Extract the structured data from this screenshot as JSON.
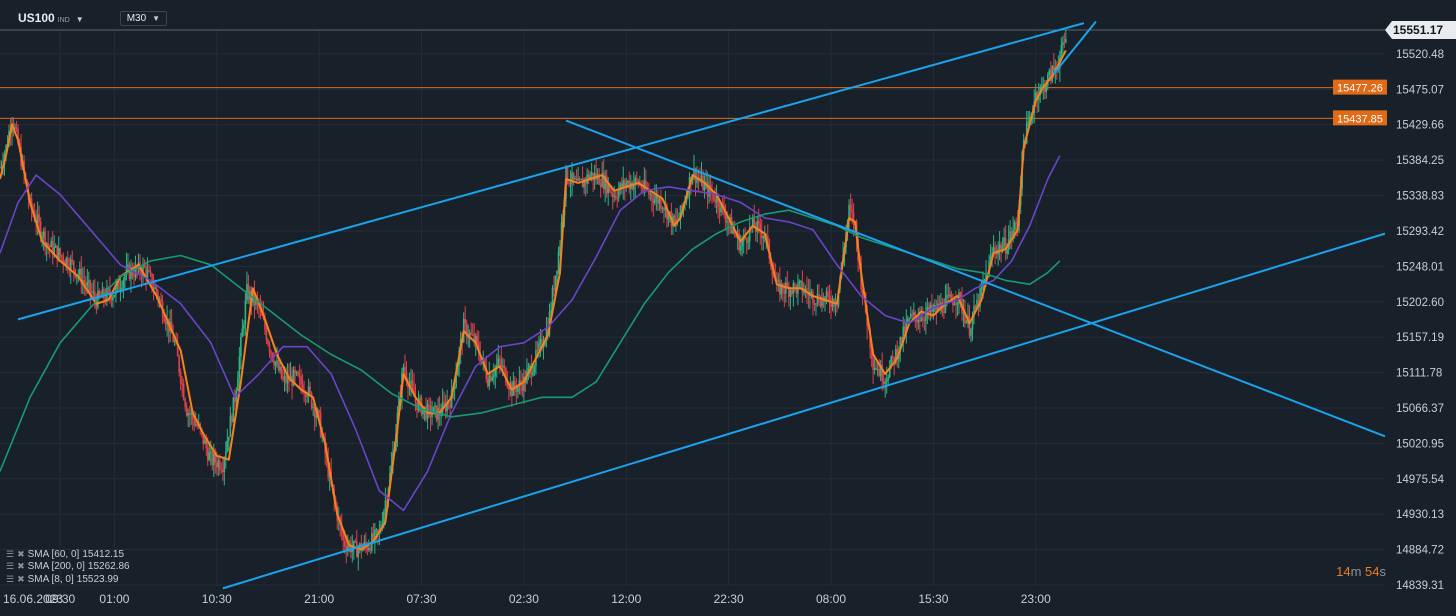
{
  "header": {
    "symbol": "US100",
    "symbol_tag": "IND",
    "timeframe": "M30"
  },
  "colors": {
    "background": "#18202a",
    "grid": "#242d38",
    "candle_up": "#2fb383",
    "candle_down": "#e0414b",
    "sma8": "#f5821f",
    "sma60": "#6a45c8",
    "sma200": "#179a73",
    "trendline": "#1aa3ec",
    "hline": "#e06a16",
    "price_tag": "#e06a16"
  },
  "chart_data": {
    "type": "line",
    "instrument": "US100",
    "timeframe": "M30",
    "ylim": [
      14839.31,
      15551.17
    ],
    "y_ticks": [
      15551.17,
      15520.48,
      15475.07,
      15429.66,
      15384.25,
      15338.83,
      15293.42,
      15248.01,
      15202.6,
      15157.19,
      15111.78,
      15066.37,
      15020.95,
      14975.54,
      14930.13,
      14884.72,
      14839.31
    ],
    "x_tick_labels": [
      "16.06.2023",
      "09:30",
      "01:00",
      "10:30",
      "21:00",
      "07:30",
      "02:30",
      "12:00",
      "22:30",
      "08:00",
      "15:30",
      "23:00"
    ],
    "current_price": "15551.17",
    "horizontal_levels": [
      "15477.26",
      "15437.85"
    ],
    "series": [
      {
        "name": "SMA [8, 0]",
        "value": "15523.99",
        "color": "#f5821f",
        "points": [
          [
            0,
            15360
          ],
          [
            2,
            15390
          ],
          [
            4,
            15430
          ],
          [
            6,
            15410
          ],
          [
            10,
            15330
          ],
          [
            14,
            15280
          ],
          [
            20,
            15255
          ],
          [
            26,
            15235
          ],
          [
            32,
            15200
          ],
          [
            36,
            15205
          ],
          [
            40,
            15235
          ],
          [
            46,
            15250
          ],
          [
            52,
            15210
          ],
          [
            60,
            15140
          ],
          [
            64,
            15060
          ],
          [
            68,
            15030
          ],
          [
            72,
            15005
          ],
          [
            76,
            15000
          ],
          [
            80,
            15100
          ],
          [
            84,
            15220
          ],
          [
            88,
            15180
          ],
          [
            92,
            15135
          ],
          [
            96,
            15105
          ],
          [
            100,
            15090
          ],
          [
            104,
            15080
          ],
          [
            108,
            15020
          ],
          [
            112,
            14930
          ],
          [
            116,
            14890
          ],
          [
            120,
            14885
          ],
          [
            124,
            14895
          ],
          [
            128,
            14920
          ],
          [
            132,
            15040
          ],
          [
            134,
            15110
          ],
          [
            138,
            15080
          ],
          [
            142,
            15060
          ],
          [
            146,
            15060
          ],
          [
            150,
            15080
          ],
          [
            154,
            15165
          ],
          [
            158,
            15150
          ],
          [
            162,
            15110
          ],
          [
            166,
            15120
          ],
          [
            170,
            15090
          ],
          [
            174,
            15100
          ],
          [
            178,
            15130
          ],
          [
            182,
            15160
          ],
          [
            186,
            15240
          ],
          [
            188,
            15360
          ],
          [
            192,
            15355
          ],
          [
            196,
            15360
          ],
          [
            200,
            15365
          ],
          [
            204,
            15345
          ],
          [
            208,
            15350
          ],
          [
            212,
            15355
          ],
          [
            216,
            15345
          ],
          [
            220,
            15335
          ],
          [
            224,
            15300
          ],
          [
            226,
            15310
          ],
          [
            230,
            15365
          ],
          [
            234,
            15355
          ],
          [
            238,
            15340
          ],
          [
            242,
            15310
          ],
          [
            246,
            15280
          ],
          [
            250,
            15300
          ],
          [
            254,
            15290
          ],
          [
            258,
            15225
          ],
          [
            262,
            15220
          ],
          [
            266,
            15220
          ],
          [
            270,
            15210
          ],
          [
            274,
            15205
          ],
          [
            278,
            15200
          ],
          [
            282,
            15310
          ],
          [
            284,
            15305
          ],
          [
            286,
            15240
          ],
          [
            290,
            15135
          ],
          [
            294,
            15110
          ],
          [
            298,
            15130
          ],
          [
            302,
            15175
          ],
          [
            306,
            15190
          ],
          [
            310,
            15185
          ],
          [
            314,
            15200
          ],
          [
            318,
            15210
          ],
          [
            322,
            15175
          ],
          [
            326,
            15205
          ],
          [
            330,
            15265
          ],
          [
            334,
            15270
          ],
          [
            338,
            15295
          ],
          [
            340,
            15400
          ],
          [
            342,
            15430
          ],
          [
            344,
            15460
          ],
          [
            346,
            15475
          ],
          [
            350,
            15495
          ],
          [
            352,
            15510
          ],
          [
            354,
            15525
          ]
        ]
      },
      {
        "name": "SMA [60, 0]",
        "value": "15412.15",
        "color": "#6a45c8",
        "points": [
          [
            0,
            15265
          ],
          [
            6,
            15330
          ],
          [
            12,
            15365
          ],
          [
            20,
            15340
          ],
          [
            30,
            15295
          ],
          [
            40,
            15250
          ],
          [
            50,
            15230
          ],
          [
            60,
            15200
          ],
          [
            70,
            15150
          ],
          [
            78,
            15080
          ],
          [
            86,
            15110
          ],
          [
            94,
            15145
          ],
          [
            102,
            15145
          ],
          [
            110,
            15110
          ],
          [
            118,
            15040
          ],
          [
            126,
            14960
          ],
          [
            134,
            14935
          ],
          [
            142,
            14985
          ],
          [
            150,
            15060
          ],
          [
            158,
            15120
          ],
          [
            166,
            15145
          ],
          [
            174,
            15150
          ],
          [
            182,
            15170
          ],
          [
            190,
            15205
          ],
          [
            198,
            15260
          ],
          [
            206,
            15320
          ],
          [
            214,
            15345
          ],
          [
            222,
            15350
          ],
          [
            230,
            15345
          ],
          [
            238,
            15340
          ],
          [
            246,
            15330
          ],
          [
            254,
            15310
          ],
          [
            262,
            15305
          ],
          [
            270,
            15295
          ],
          [
            278,
            15250
          ],
          [
            286,
            15210
          ],
          [
            294,
            15185
          ],
          [
            302,
            15175
          ],
          [
            310,
            15195
          ],
          [
            318,
            15205
          ],
          [
            324,
            15220
          ],
          [
            330,
            15230
          ],
          [
            336,
            15255
          ],
          [
            342,
            15300
          ],
          [
            348,
            15360
          ],
          [
            352,
            15390
          ]
        ]
      },
      {
        "name": "SMA [200, 0]",
        "value": "15262.86",
        "color": "#179a73",
        "points": [
          [
            0,
            14985
          ],
          [
            10,
            15080
          ],
          [
            20,
            15150
          ],
          [
            30,
            15195
          ],
          [
            40,
            15235
          ],
          [
            50,
            15255
          ],
          [
            60,
            15262
          ],
          [
            70,
            15250
          ],
          [
            80,
            15220
          ],
          [
            90,
            15190
          ],
          [
            100,
            15160
          ],
          [
            110,
            15135
          ],
          [
            120,
            15115
          ],
          [
            130,
            15085
          ],
          [
            140,
            15065
          ],
          [
            150,
            15055
          ],
          [
            160,
            15060
          ],
          [
            170,
            15070
          ],
          [
            180,
            15080
          ],
          [
            190,
            15080
          ],
          [
            198,
            15100
          ],
          [
            206,
            15150
          ],
          [
            214,
            15200
          ],
          [
            222,
            15240
          ],
          [
            230,
            15270
          ],
          [
            238,
            15290
          ],
          [
            246,
            15305
          ],
          [
            254,
            15315
          ],
          [
            262,
            15320
          ],
          [
            270,
            15310
          ],
          [
            278,
            15300
          ],
          [
            286,
            15285
          ],
          [
            294,
            15275
          ],
          [
            302,
            15265
          ],
          [
            310,
            15255
          ],
          [
            318,
            15245
          ],
          [
            326,
            15240
          ],
          [
            334,
            15230
          ],
          [
            342,
            15225
          ],
          [
            348,
            15240
          ],
          [
            352,
            15255
          ]
        ]
      }
    ],
    "trendlines": [
      {
        "name": "upper-channel",
        "from": [
          6,
          15180
        ],
        "to": [
          360,
          15560
        ]
      },
      {
        "name": "lower-channel",
        "from": [
          74,
          14835
        ],
        "to": [
          460,
          15290
        ]
      },
      {
        "name": "descending",
        "from": [
          188,
          15435
        ],
        "to": [
          460,
          15030
        ]
      },
      {
        "name": "steep-breakout",
        "from": [
          350,
          15495
        ],
        "to": [
          364,
          15562
        ]
      }
    ],
    "candle_trend": [
      [
        0,
        15375
      ],
      [
        2,
        15400
      ],
      [
        4,
        15440
      ],
      [
        6,
        15405
      ],
      [
        10,
        15325
      ],
      [
        16,
        15275
      ],
      [
        24,
        15250
      ],
      [
        32,
        15205
      ],
      [
        38,
        15215
      ],
      [
        42,
        15240
      ],
      [
        48,
        15245
      ],
      [
        52,
        15215
      ],
      [
        58,
        15150
      ],
      [
        62,
        15065
      ],
      [
        66,
        15040
      ],
      [
        70,
        15000
      ],
      [
        74,
        14995
      ],
      [
        78,
        15080
      ],
      [
        82,
        15215
      ],
      [
        86,
        15195
      ],
      [
        90,
        15140
      ],
      [
        94,
        15100
      ],
      [
        98,
        15105
      ],
      [
        102,
        15090
      ],
      [
        106,
        15050
      ],
      [
        110,
        14965
      ],
      [
        114,
        14895
      ],
      [
        118,
        14885
      ],
      [
        122,
        14890
      ],
      [
        126,
        14905
      ],
      [
        130,
        14990
      ],
      [
        134,
        15120
      ],
      [
        138,
        15075
      ],
      [
        142,
        15060
      ],
      [
        146,
        15060
      ],
      [
        150,
        15080
      ],
      [
        154,
        15170
      ],
      [
        158,
        15150
      ],
      [
        162,
        15105
      ],
      [
        166,
        15125
      ],
      [
        170,
        15090
      ],
      [
        174,
        15100
      ],
      [
        178,
        15130
      ],
      [
        182,
        15170
      ],
      [
        186,
        15280
      ],
      [
        188,
        15365
      ],
      [
        192,
        15350
      ],
      [
        196,
        15365
      ],
      [
        200,
        15360
      ],
      [
        204,
        15340
      ],
      [
        208,
        15355
      ],
      [
        212,
        15355
      ],
      [
        216,
        15340
      ],
      [
        220,
        15330
      ],
      [
        224,
        15300
      ],
      [
        226,
        15315
      ],
      [
        230,
        15370
      ],
      [
        234,
        15350
      ],
      [
        238,
        15335
      ],
      [
        242,
        15305
      ],
      [
        246,
        15275
      ],
      [
        250,
        15300
      ],
      [
        254,
        15290
      ],
      [
        258,
        15220
      ],
      [
        262,
        15220
      ],
      [
        266,
        15220
      ],
      [
        270,
        15210
      ],
      [
        274,
        15205
      ],
      [
        278,
        15205
      ],
      [
        282,
        15320
      ],
      [
        284,
        15300
      ],
      [
        286,
        15230
      ],
      [
        290,
        15125
      ],
      [
        294,
        15105
      ],
      [
        298,
        15140
      ],
      [
        302,
        15180
      ],
      [
        306,
        15185
      ],
      [
        310,
        15190
      ],
      [
        314,
        15200
      ],
      [
        318,
        15210
      ],
      [
        322,
        15170
      ],
      [
        326,
        15215
      ],
      [
        330,
        15270
      ],
      [
        334,
        15275
      ],
      [
        338,
        15305
      ],
      [
        340,
        15410
      ],
      [
        342,
        15435
      ],
      [
        344,
        15470
      ],
      [
        346,
        15475
      ],
      [
        350,
        15500
      ],
      [
        352,
        15515
      ],
      [
        354,
        15540
      ]
    ]
  },
  "legend": [
    {
      "label": "SMA [60, 0]",
      "value": "15412.15"
    },
    {
      "label": "SMA [200, 0]",
      "value": "15262.86"
    },
    {
      "label": "SMA [8, 0]",
      "value": "15523.99"
    }
  ],
  "timer": {
    "minutes": "14",
    "m": "m",
    "seconds": "54",
    "s": "s"
  }
}
